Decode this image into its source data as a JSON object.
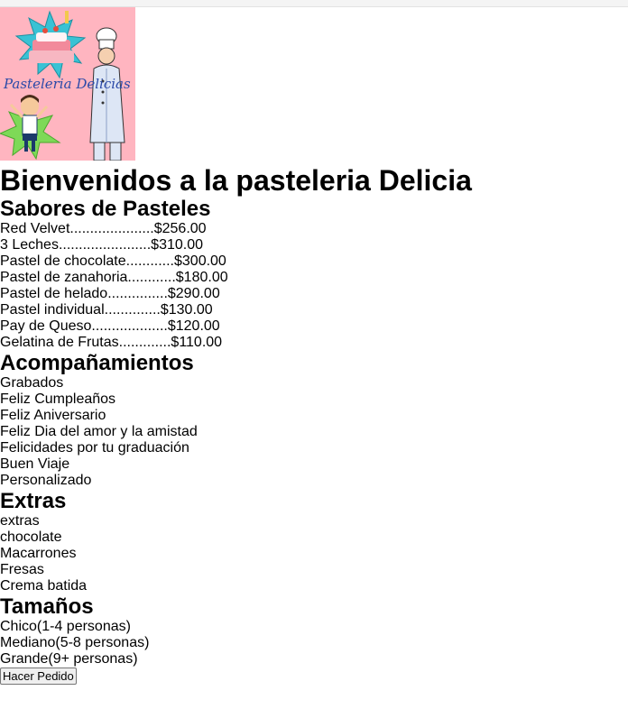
{
  "logo": {
    "alt": "Pasteleria Delicias",
    "text": "Pasteleria Delicias",
    "bg": "#ffb5c0"
  },
  "title": "Bienvenidos a la pasteleria Delicia",
  "sabores": {
    "heading": "Sabores de Pasteles",
    "items": [
      "Red Velvet.....................$256.00",
      "3 Leches.......................$310.00",
      "Pastel de chocolate............$300.00",
      "Pastel de zanahoria............$180.00",
      "Pastel de helado...............$290.00",
      "Pastel individual..............$130.00",
      "Pay de Queso...................$120.00",
      "Gelatina de Frutas.............$110.00"
    ]
  },
  "acompanamientos": {
    "heading": "Acompañamientos",
    "items": [
      "Grabados",
      "Feliz Cumpleaños",
      "Feliz Aniversario",
      "Feliz Dia del amor y la amistad",
      "Felicidades por tu graduación",
      "Buen Viaje",
      "Personalizado"
    ]
  },
  "extras": {
    "heading": "Extras",
    "items": [
      "extras",
      "chocolate",
      "Macarrones",
      "Fresas",
      "Crema batida"
    ]
  },
  "tamanos": {
    "heading": "Tamaños",
    "items": [
      "Chico(1-4 personas)",
      "Mediano(5-8 personas)",
      "Grande(9+ personas)"
    ]
  },
  "order_button": "Hacer Pedido"
}
